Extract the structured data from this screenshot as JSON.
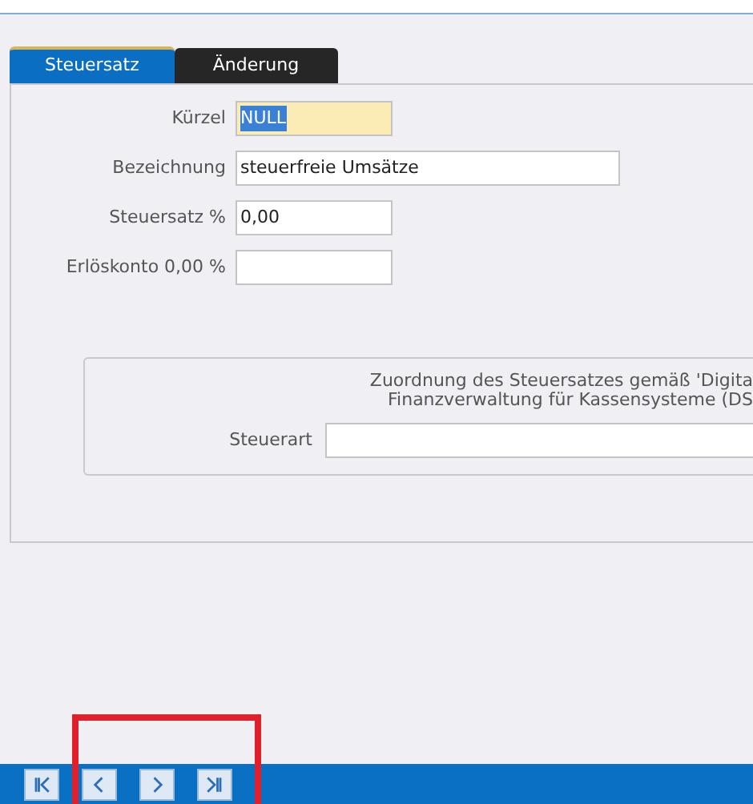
{
  "tabs": [
    {
      "label": "Steuersatz",
      "selected": true
    },
    {
      "label": "Änderung",
      "selected": false
    }
  ],
  "fields": [
    {
      "label": "Kürzel",
      "value": "NULL",
      "kind": "highlighted",
      "text_selected": true
    },
    {
      "label": "Bezeichnung",
      "value": "steuerfreie Umsätze",
      "kind": "wide",
      "text_selected": false
    },
    {
      "label": "Steuersatz %",
      "value": "0,00",
      "kind": "short",
      "text_selected": false
    },
    {
      "label": "Erlöskonto 0,00 %",
      "kind": "short"
    }
  ],
  "group": {
    "heading_lines": [
      "Zuordnung des Steuersatzes gemäß 'Digita",
      "Finanzverwaltung für Kassensysteme (DS"
    ],
    "field_label": "Steuerart"
  },
  "navigation": [
    {
      "kind": "first"
    },
    {
      "kind": "previous"
    },
    {
      "kind": "next"
    },
    {
      "kind": "last"
    }
  ],
  "highlight_frame": true
}
